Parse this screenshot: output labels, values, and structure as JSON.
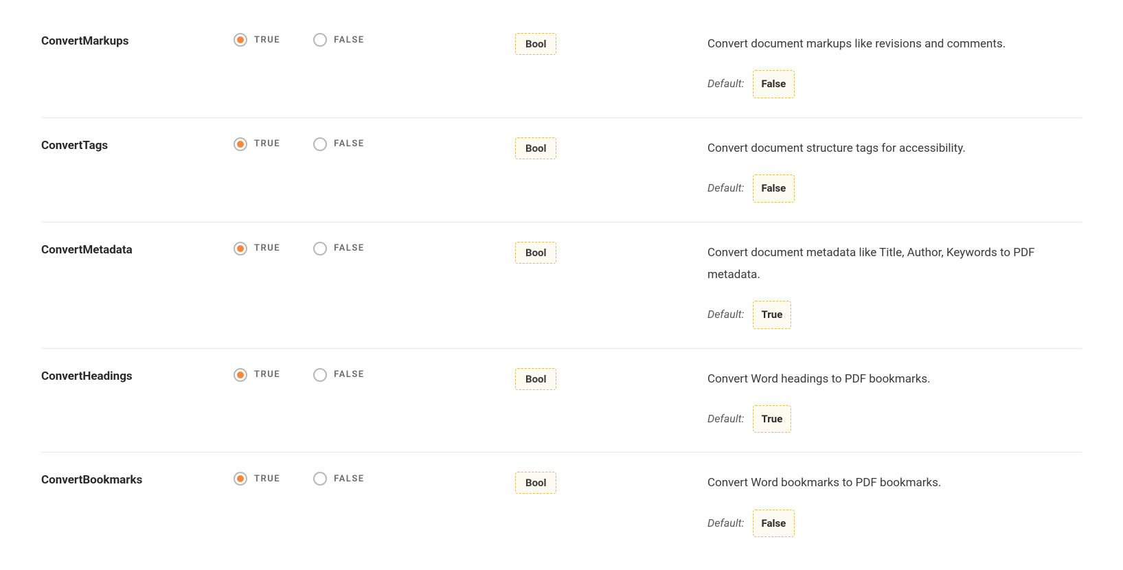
{
  "labels": {
    "true": "TRUE",
    "false": "FALSE",
    "default": "Default:"
  },
  "type_badge": "Bool",
  "rows": [
    {
      "name": "ConvertMarkups",
      "selected": "true",
      "type": "Bool",
      "description": "Convert document markups like revisions and comments.",
      "default": "False"
    },
    {
      "name": "ConvertTags",
      "selected": "true",
      "type": "Bool",
      "description": "Convert document structure tags for accessibility.",
      "default": "False"
    },
    {
      "name": "ConvertMetadata",
      "selected": "true",
      "type": "Bool",
      "description": "Convert document metadata like Title, Author, Keywords to PDF metadata.",
      "default": "True"
    },
    {
      "name": "ConvertHeadings",
      "selected": "true",
      "type": "Bool",
      "description": "Convert Word headings to PDF bookmarks.",
      "default": "True"
    },
    {
      "name": "ConvertBookmarks",
      "selected": "true",
      "type": "Bool",
      "description": "Convert Word bookmarks to PDF bookmarks.",
      "default": "False"
    }
  ]
}
